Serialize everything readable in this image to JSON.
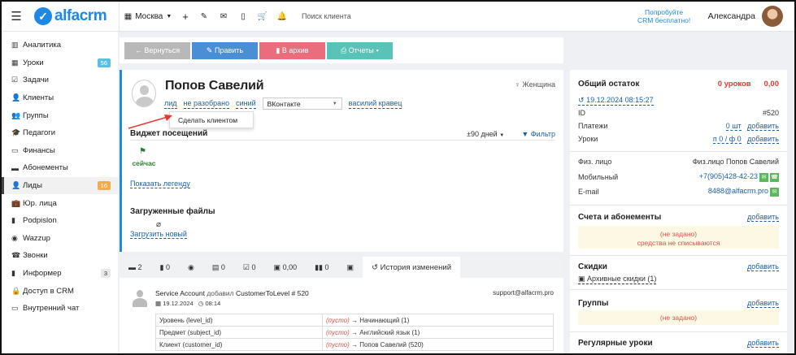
{
  "topbar": {
    "logo_text": "alfacrm",
    "city": "Москва",
    "search_placeholder": "Поиск клиента",
    "try_line1": "Попробуйте",
    "try_line2": "CRM бесплатно!",
    "user_name": "Александра"
  },
  "sidebar": {
    "items": [
      {
        "label": "Аналитика",
        "icon": "▥"
      },
      {
        "label": "Уроки",
        "icon": "▦",
        "badge": "56"
      },
      {
        "label": "Задачи",
        "icon": "☑"
      },
      {
        "label": "Клиенты",
        "icon": "👤"
      },
      {
        "label": "Группы",
        "icon": "👥"
      },
      {
        "label": "Педагоги",
        "icon": "🎓"
      },
      {
        "label": "Финансы",
        "icon": "▭"
      },
      {
        "label": "Абонементы",
        "icon": "▬"
      },
      {
        "label": "Лиды",
        "icon": "👤",
        "badge": "16"
      },
      {
        "label": "Юр. лица",
        "icon": "💼"
      },
      {
        "label": "Podpislon",
        "icon": "▮"
      },
      {
        "label": "Wazzup",
        "icon": "◉"
      },
      {
        "label": "Звонки",
        "icon": "☎"
      },
      {
        "label": "Информер",
        "icon": "▮",
        "badge": "3"
      },
      {
        "label": "Доступ в CRM",
        "icon": "🔒"
      },
      {
        "label": "Внутренний чат",
        "icon": "▭"
      }
    ]
  },
  "actions": {
    "back": "← Вернуться",
    "edit": "✎ Править",
    "archive": "▮ В архив",
    "reports": "⎙ Отчеты ▾"
  },
  "client": {
    "name": "Попов Савелий",
    "gender": "Женщина",
    "tag1": "лид",
    "tag2": "не разобрано",
    "tag3": "синий",
    "source_select": "ВКонтакте",
    "manager": "василий кравец",
    "dropdown_item": "Сделать клиентом"
  },
  "visits": {
    "title": "Виджет посещений",
    "period": "±90 дней",
    "filter": "Фильтр",
    "now_label": "сейчас",
    "legend_link": "Показать легенду"
  },
  "files": {
    "title": "Загруженные файлы",
    "upload_link": "Загрузить новый"
  },
  "tabs": {
    "items": [
      "2",
      "0",
      "",
      "0",
      "0",
      "0,00",
      "0",
      ""
    ],
    "history": "История изменений"
  },
  "history": {
    "author": "Service Account",
    "action": "добавил",
    "entity": "CustomerToLevel # 520",
    "email": "support@alfacrm.pro",
    "date": "19.12.2024",
    "time": "08:14",
    "rows": [
      {
        "field": "Уровень (level_id)",
        "old": "(пусто)",
        "new": "Начинающий (1)"
      },
      {
        "field": "Предмет (subject_id)",
        "old": "(пусто)",
        "new": "Английский язык (1)"
      },
      {
        "field": "Клиент (customer_id)",
        "old": "(пусто)",
        "new": "Попов Савелий (520)"
      }
    ]
  },
  "right": {
    "balance_title": "Общий остаток",
    "lessons": "0 уроков",
    "amount": "0,00",
    "date_link": "19.12.2024 08:15:27",
    "id_label": "ID",
    "id_value": "#520",
    "payments_label": "Платежи",
    "payments_value": "0 шт",
    "lessons_label": "Уроки",
    "lessons_value": "п 0 / ф 0",
    "add": "добавить",
    "person_label": "Физ. лицо",
    "person_value": "Физ.лицо Попов Савелий",
    "mobile_label": "Мобильный",
    "mobile_value": "+7(905)428-42-23",
    "email_label": "E-mail",
    "email_value": "8488@alfacrm.pro",
    "accounts_title": "Счета и абонементы",
    "not_set": "(не задано)",
    "no_charge": "средства не списываются",
    "discounts_title": "Скидки",
    "archive_discounts": "Архивные скидки (1)",
    "groups_title": "Группы",
    "regular_title": "Регулярные уроки"
  },
  "colors": {
    "accent": "#1e88e5",
    "back_btn": "#b8b8b8",
    "edit_btn": "#4a8fd6",
    "archive_btn": "#ea6c7d",
    "reports_btn": "#58c3b6",
    "danger": "#e53935"
  }
}
